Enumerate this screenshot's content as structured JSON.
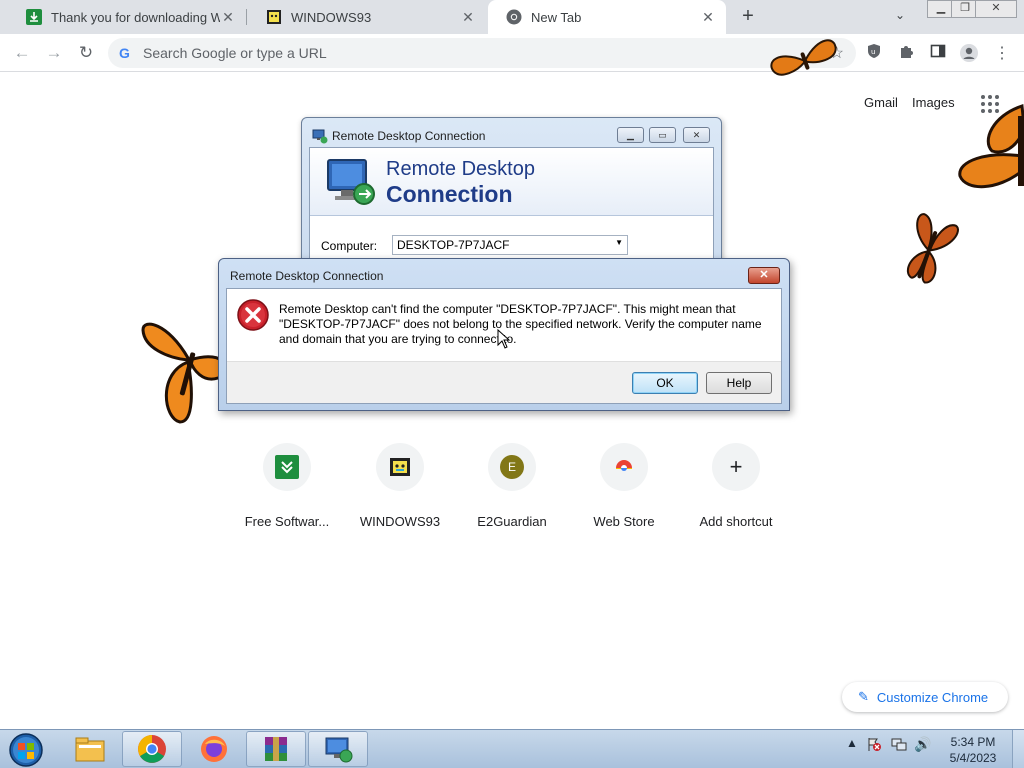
{
  "browser": {
    "tabs": [
      {
        "title": "Thank you for downloading WinF",
        "favicon": "green-download-icon",
        "active": false
      },
      {
        "title": "WINDOWS93",
        "favicon": "windows93-icon",
        "active": false
      },
      {
        "title": "New Tab",
        "favicon": "chrome-icon",
        "active": true
      }
    ],
    "new_tab_symbol": "+",
    "omnibox_placeholder": "Search Google or type a URL"
  },
  "ntp": {
    "links": [
      "Gmail",
      "Images"
    ],
    "shortcuts": [
      {
        "label": "Free Softwar...",
        "icon": "download-arrow-icon"
      },
      {
        "label": "WINDOWS93",
        "icon": "windows93-icon"
      },
      {
        "label": "E2Guardian",
        "icon": "letter-e-icon",
        "letter": "E"
      },
      {
        "label": "Web Store",
        "icon": "webstore-icon"
      },
      {
        "label": "Add shortcut",
        "icon": "plus-icon",
        "symbol": "+"
      }
    ],
    "customize_label": "Customize Chrome"
  },
  "rdc_window": {
    "title": "Remote Desktop Connection",
    "banner_line1": "Remote Desktop",
    "banner_line2": "Connection",
    "computer_label": "Computer:",
    "computer_value": "DESKTOP-7P7JACF"
  },
  "error_dialog": {
    "title": "Remote Desktop Connection",
    "message": "Remote Desktop can't find the computer \"DESKTOP-7P7JACF\". This might mean that \"DESKTOP-7P7JACF\" does not belong to the specified network.  Verify the computer name and domain that you are trying to connect to.",
    "ok_label": "OK",
    "help_label": "Help"
  },
  "taskbar": {
    "apps": [
      "explorer-icon",
      "chrome-icon",
      "firefox-icon",
      "winrar-icon",
      "remote-desktop-icon"
    ],
    "time": "5:34 PM",
    "date": "5/4/2023"
  },
  "colors": {
    "chrome_tabstrip": "#dee1e6",
    "accent_blue": "#1a73e8",
    "rdc_title_blue": "#1f3c88",
    "error_red": "#c8202a"
  }
}
